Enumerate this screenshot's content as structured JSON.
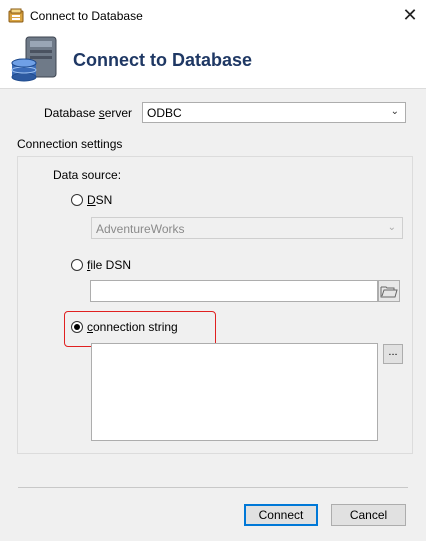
{
  "window": {
    "title": "Connect to Database",
    "close_glyph": "✕"
  },
  "header": {
    "title": "Connect to Database",
    "icon": "database-server-icon"
  },
  "server": {
    "label_pre": "Database ",
    "label_accel": "s",
    "label_post": "erver",
    "value": "ODBC"
  },
  "connection_settings": {
    "label": "Connection settings",
    "data_source_label": "Data source:",
    "options": {
      "dsn": {
        "accel": "D",
        "rest": "SN",
        "selected": false,
        "value": "AdventureWorks"
      },
      "file_dsn": {
        "accel": "f",
        "rest": "ile DSN",
        "selected": false,
        "value": ""
      },
      "connection_string": {
        "accel": "c",
        "rest": "onnection string",
        "selected": true,
        "value": ""
      }
    },
    "ellipsis_label": "..."
  },
  "buttons": {
    "connect": "Connect",
    "cancel": "Cancel"
  },
  "colors": {
    "header_title": "#1f3864",
    "highlight": "#e02020",
    "default_button_border": "#0078d7"
  }
}
